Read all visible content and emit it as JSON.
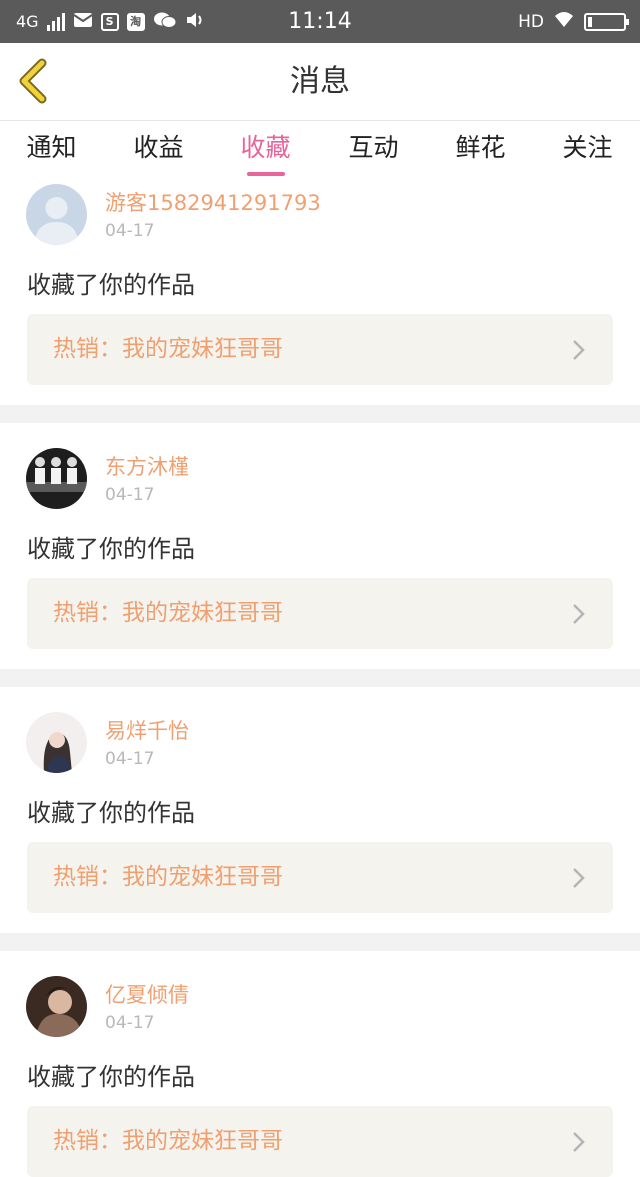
{
  "status_bar": {
    "network": "4G",
    "time": "11:14",
    "hd": "HD",
    "app_icons": [
      "mail-icon",
      "s-icon",
      "taobao-icon",
      "wechat-icon",
      "volume-icon"
    ]
  },
  "header": {
    "title": "消息"
  },
  "tabs": [
    {
      "label": "通知"
    },
    {
      "label": "收益"
    },
    {
      "label": "收藏",
      "active": true
    },
    {
      "label": "互动"
    },
    {
      "label": "鲜花"
    },
    {
      "label": "关注"
    }
  ],
  "colors": {
    "accent": "#e8649a",
    "username": "#f0a070",
    "work_box_bg": "#f4f3ee"
  },
  "items": [
    {
      "user": "游客1582941291793",
      "date": "04-17",
      "action": "收藏了你的作品",
      "work": "热销：我的宠妹狂哥哥"
    },
    {
      "user": "东方沐槿",
      "date": "04-17",
      "action": "收藏了你的作品",
      "work": "热销：我的宠妹狂哥哥"
    },
    {
      "user": "易烊千怡",
      "date": "04-17",
      "action": "收藏了你的作品",
      "work": "热销：我的宠妹狂哥哥"
    },
    {
      "user": "亿夏倾倩",
      "date": "04-17",
      "action": "收藏了你的作品",
      "work": "热销：我的宠妹狂哥哥"
    }
  ]
}
